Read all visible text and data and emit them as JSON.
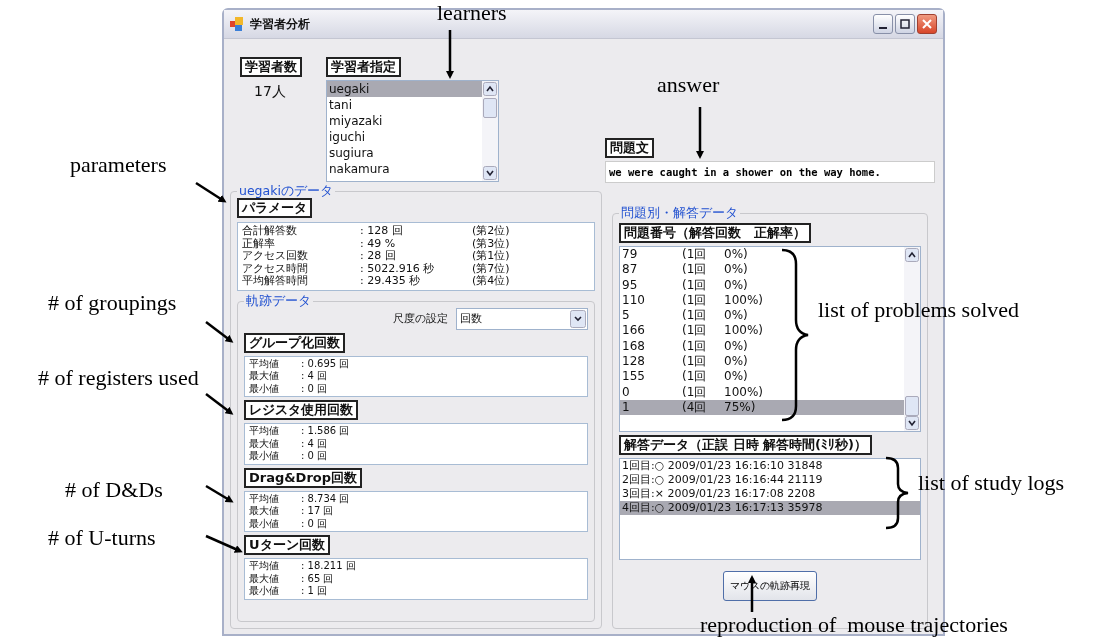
{
  "window": {
    "title": "学習者分析"
  },
  "learner_count": {
    "label": "学習者数",
    "value": "17人"
  },
  "learner_select": {
    "label": "学習者指定",
    "items": [
      {
        "name": "uegaki",
        "selected": true
      },
      {
        "name": "tani",
        "selected": false
      },
      {
        "name": "miyazaki",
        "selected": false
      },
      {
        "name": "iguchi",
        "selected": false
      },
      {
        "name": "sugiura",
        "selected": false
      },
      {
        "name": "nakamura",
        "selected": false
      }
    ]
  },
  "problem_text": {
    "label": "問題文",
    "value": "we were caught in a shower on the way home."
  },
  "learner_data": {
    "title": "uegakiのデータ",
    "parameters": {
      "label": "パラメータ",
      "rows": [
        {
          "name": "合計解答数",
          "value": ": 128 回",
          "rank": "(第2位)"
        },
        {
          "name": "正解率",
          "value": ": 49 %",
          "rank": "(第3位)"
        },
        {
          "name": "アクセス回数",
          "value": ": 28 回",
          "rank": "(第1位)"
        },
        {
          "name": "アクセス時間",
          "value": ": 5022.916 秒",
          "rank": "(第7位)"
        },
        {
          "name": "平均解答時間",
          "value": ": 29.435 秒",
          "rank": "(第4位)"
        }
      ]
    },
    "trajectory": {
      "title": "軌跡データ",
      "scale": {
        "label": "尺度の設定",
        "value": "回数"
      },
      "sections": [
        {
          "label": "グループ化回数",
          "rows": [
            {
              "name": "平均値",
              "value": ": 0.695 回"
            },
            {
              "name": "最大値",
              "value": ": 4 回"
            },
            {
              "name": "最小値",
              "value": ": 0 回"
            }
          ]
        },
        {
          "label": "レジスタ使用回数",
          "rows": [
            {
              "name": "平均値",
              "value": ": 1.586 回"
            },
            {
              "name": "最大値",
              "value": ": 4 回"
            },
            {
              "name": "最小値",
              "value": ": 0 回"
            }
          ]
        },
        {
          "label": "Drag&Drop回数",
          "rows": [
            {
              "name": "平均値",
              "value": ": 8.734 回"
            },
            {
              "name": "最大値",
              "value": ": 17 回"
            },
            {
              "name": "最小値",
              "value": ": 0 回"
            }
          ]
        },
        {
          "label": "Uターン回数",
          "rows": [
            {
              "name": "平均値",
              "value": ": 18.211 回"
            },
            {
              "name": "最大値",
              "value": ": 65 回"
            },
            {
              "name": "最小値",
              "value": ": 1 回"
            }
          ]
        }
      ]
    }
  },
  "problem_data": {
    "title": "問題別・解答データ",
    "list_header": "問題番号（解答回数　正解率）",
    "problems": [
      {
        "number": "79",
        "count": "(1回",
        "rate": "0%)",
        "selected": false
      },
      {
        "number": "87",
        "count": "(1回",
        "rate": "0%)",
        "selected": false
      },
      {
        "number": "95",
        "count": "(1回",
        "rate": "0%)",
        "selected": false
      },
      {
        "number": "110",
        "count": "(1回",
        "rate": "100%)",
        "selected": false
      },
      {
        "number": "5",
        "count": "(1回",
        "rate": "0%)",
        "selected": false
      },
      {
        "number": "166",
        "count": "(1回",
        "rate": "100%)",
        "selected": false
      },
      {
        "number": "168",
        "count": "(1回",
        "rate": "0%)",
        "selected": false
      },
      {
        "number": "128",
        "count": "(1回",
        "rate": "0%)",
        "selected": false
      },
      {
        "number": "155",
        "count": "(1回",
        "rate": "0%)",
        "selected": false
      },
      {
        "number": "0",
        "count": "(1回",
        "rate": "100%)",
        "selected": false
      },
      {
        "number": "1",
        "count": "(4回",
        "rate": "75%)",
        "selected": true
      }
    ],
    "log_header": "解答データ（正誤 日時 解答時間(ﾐﾘ秒)）",
    "logs": [
      {
        "text": "1回目:○ 2009/01/23 16:16:10 31848",
        "selected": false
      },
      {
        "text": "2回目:○ 2009/01/23 16:16:44 21119",
        "selected": false
      },
      {
        "text": "3回目:× 2009/01/23 16:17:08 2208",
        "selected": false
      },
      {
        "text": "4回目:○ 2009/01/23 16:17:13 35978",
        "selected": true
      }
    ],
    "button": "マウスの軌跡再現"
  },
  "annotations": [
    {
      "text": "learners"
    },
    {
      "text": "answer"
    },
    {
      "text": "parameters"
    },
    {
      "text": "# of groupings"
    },
    {
      "text": "# of registers used"
    },
    {
      "text": "# of D&Ds"
    },
    {
      "text": "# of U-turns"
    },
    {
      "text": "list of problems solved"
    },
    {
      "text": "list of study logs"
    },
    {
      "text": "reproduction of  mouse trajectories"
    }
  ]
}
